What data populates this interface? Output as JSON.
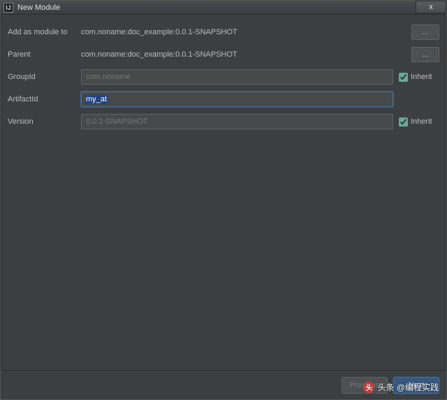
{
  "window": {
    "title": "New Module",
    "app_icon_glyph": "IJ",
    "close_glyph": "x"
  },
  "form": {
    "add_as_module": {
      "label": "Add as module to",
      "value": "com.noname:doc_example:0.0.1-SNAPSHOT",
      "browse": "..."
    },
    "parent": {
      "label": "Parent",
      "value": "com.noname:doc_example:0.0.1-SNAPSHOT",
      "browse": "..."
    },
    "group_id": {
      "label": "GroupId",
      "value": "com.noname",
      "inherit_label": "Inherit",
      "inherit_checked": true
    },
    "artifact_id": {
      "label": "ArtifactId",
      "value": "my_at"
    },
    "version": {
      "label": "Version",
      "value": "0.0.1-SNAPSHOT",
      "inherit_label": "Inherit",
      "inherit_checked": true
    }
  },
  "footer": {
    "previous": "Previous",
    "next": "Next"
  },
  "watermark": {
    "badge": "头",
    "text": "头条 @编程实践"
  }
}
